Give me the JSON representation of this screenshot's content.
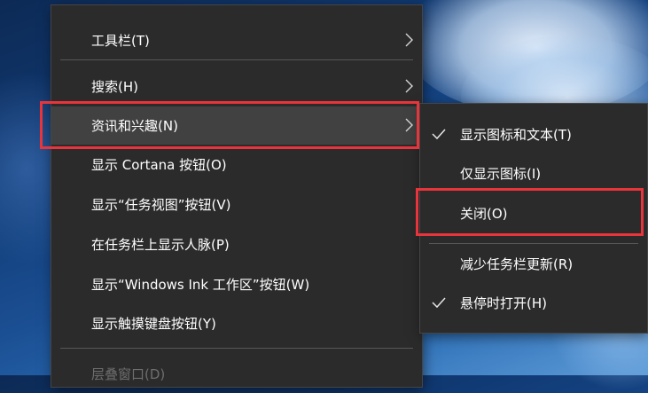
{
  "context_menu": {
    "items": [
      {
        "label": "工具栏(T)"
      },
      {
        "label": "搜索(H)"
      },
      {
        "label": "资讯和兴趣(N)"
      },
      {
        "label": "显示 Cortana 按钮(O)"
      },
      {
        "label": "显示“任务视图”按钮(V)"
      },
      {
        "label": "在任务栏上显示人脉(P)"
      },
      {
        "label": "显示“Windows Ink 工作区”按钮(W)"
      },
      {
        "label": "显示触摸键盘按钮(Y)"
      },
      {
        "label": "层叠窗口(D)"
      }
    ]
  },
  "submenu": {
    "items": [
      {
        "label": "显示图标和文本(T)",
        "checked": true
      },
      {
        "label": "仅显示图标(I)",
        "checked": false
      },
      {
        "label": "关闭(O)",
        "checked": false
      },
      {
        "label": "减少任务栏更新(R)",
        "checked": false
      },
      {
        "label": "悬停时打开(H)",
        "checked": true
      }
    ]
  },
  "colors": {
    "menu_background": "#2b2b2b",
    "hover_background": "#414141",
    "highlight_box": "#e8343a",
    "text": "#ffffff",
    "disabled_text": "#6e6e6e"
  }
}
